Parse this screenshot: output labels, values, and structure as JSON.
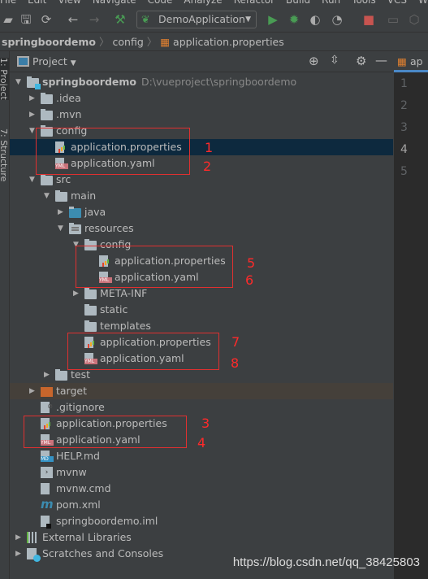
{
  "menu": [
    "File",
    "Edit",
    "View",
    "Navigate",
    "Code",
    "Analyze",
    "Refactor",
    "Build",
    "Run",
    "Tools",
    "VCS",
    "W"
  ],
  "toolbar": {
    "run_config": "DemoApplication"
  },
  "breadcrumb": [
    "springboordemo",
    "config",
    "application.properties"
  ],
  "tool_windows": {
    "project": "1: Project",
    "structure": "7: Structure"
  },
  "project_panel": {
    "title": "Project"
  },
  "tree": [
    {
      "label": "springboordemo",
      "hint": "D:\\vueproject\\springboordemo",
      "level": 0,
      "arrow": "open",
      "icon": "module-folder",
      "bold": true
    },
    {
      "label": ".idea",
      "level": 1,
      "arrow": "closed",
      "icon": "folder"
    },
    {
      "label": ".mvn",
      "level": 1,
      "arrow": "closed",
      "icon": "folder"
    },
    {
      "label": "config",
      "level": 1,
      "arrow": "open",
      "icon": "folder"
    },
    {
      "label": "application.properties",
      "level": 2,
      "icon": "properties",
      "selected": true
    },
    {
      "label": "application.yaml",
      "level": 2,
      "icon": "yaml"
    },
    {
      "label": "src",
      "level": 1,
      "arrow": "open",
      "icon": "folder"
    },
    {
      "label": "main",
      "level": 2,
      "arrow": "open",
      "icon": "folder"
    },
    {
      "label": "java",
      "level": 3,
      "arrow": "closed",
      "icon": "source-folder"
    },
    {
      "label": "resources",
      "level": 3,
      "arrow": "open",
      "icon": "resources-folder"
    },
    {
      "label": "config",
      "level": 4,
      "arrow": "open",
      "icon": "folder"
    },
    {
      "label": "application.properties",
      "level": 5,
      "icon": "properties"
    },
    {
      "label": "application.yaml",
      "level": 5,
      "icon": "yaml"
    },
    {
      "label": "META-INF",
      "level": 4,
      "arrow": "closed",
      "icon": "folder"
    },
    {
      "label": "static",
      "level": 4,
      "icon": "folder"
    },
    {
      "label": "templates",
      "level": 4,
      "icon": "folder"
    },
    {
      "label": "application.properties",
      "level": 4,
      "icon": "properties"
    },
    {
      "label": "application.yaml",
      "level": 4,
      "icon": "yaml"
    },
    {
      "label": "test",
      "level": 2,
      "arrow": "closed",
      "icon": "folder"
    },
    {
      "label": "target",
      "level": 1,
      "arrow": "closed",
      "icon": "excluded-folder",
      "excluded": true
    },
    {
      "label": ".gitignore",
      "level": 1,
      "icon": "ignore-file"
    },
    {
      "label": "application.properties",
      "level": 1,
      "icon": "properties"
    },
    {
      "label": "application.yaml",
      "level": 1,
      "icon": "yaml"
    },
    {
      "label": "HELP.md",
      "level": 1,
      "icon": "markdown"
    },
    {
      "label": "mvnw",
      "level": 1,
      "icon": "shell"
    },
    {
      "label": "mvnw.cmd",
      "level": 1,
      "icon": "text-file"
    },
    {
      "label": "pom.xml",
      "level": 1,
      "icon": "maven"
    },
    {
      "label": "springboordemo.iml",
      "level": 1,
      "icon": "iml"
    },
    {
      "label": "External Libraries",
      "level": 0,
      "arrow": "closed",
      "icon": "libraries"
    },
    {
      "label": "Scratches and Consoles",
      "level": 0,
      "arrow": "closed",
      "icon": "scratches"
    }
  ],
  "annotations": [
    "1",
    "2",
    "3",
    "4",
    "5",
    "6",
    "7",
    "8"
  ],
  "editor": {
    "tab": "ap",
    "line_numbers": [
      "1",
      "2",
      "3",
      "4",
      "5"
    ],
    "current_line": 4
  },
  "watermark": "https://blog.csdn.net/qq_38425803",
  "colors": {
    "selection": "#0d293e",
    "excluded": "#45403a",
    "annotation": "#ff2a2a",
    "run": "#499c54",
    "stop": "#c75450"
  }
}
